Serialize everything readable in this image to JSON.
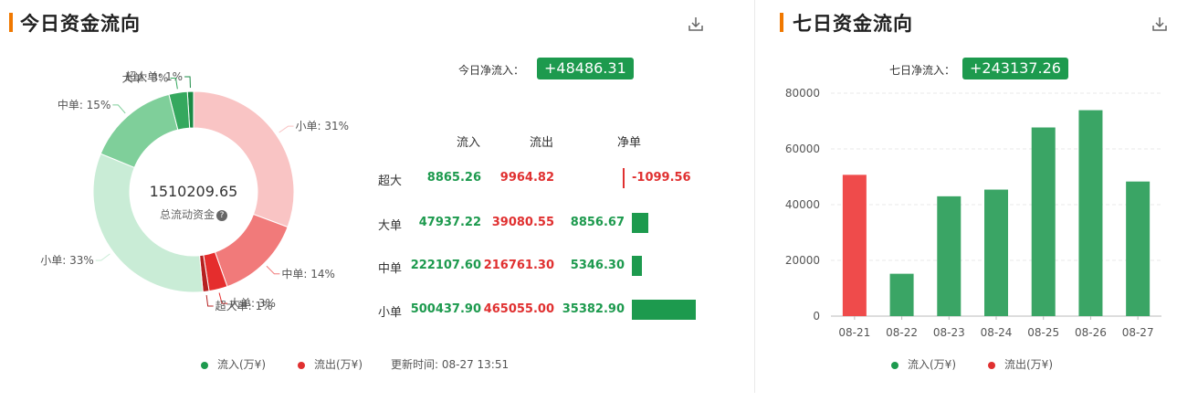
{
  "today": {
    "title": "今日资金流向",
    "net_label": "今日净流入：",
    "net_value": "+48486.31",
    "donut_total": "1510209.65",
    "donut_sub": "总流动资金",
    "table": {
      "headers": [
        "流入",
        "流出",
        "净单"
      ],
      "rows": [
        {
          "name": "超大",
          "inflow": "8865.26",
          "outflow": "9964.82",
          "net": "-1099.56",
          "net_num": -1099.56
        },
        {
          "name": "大单",
          "inflow": "47937.22",
          "outflow": "39080.55",
          "net": "8856.67",
          "net_num": 8856.67
        },
        {
          "name": "中单",
          "inflow": "222107.60",
          "outflow": "216761.30",
          "net": "5346.30",
          "net_num": 5346.3
        },
        {
          "name": "小单",
          "inflow": "500437.90",
          "outflow": "465055.00",
          "net": "35382.90",
          "net_num": 35382.9
        }
      ]
    },
    "legend": {
      "inflow": "流入(万¥)",
      "outflow": "流出(万¥)",
      "update": "更新时间: 08-27 13:51"
    }
  },
  "week": {
    "title": "七日资金流向",
    "net_label": "七日净流入：",
    "net_value": "+243137.26",
    "legend": {
      "inflow": "流入(万¥)",
      "outflow": "流出(万¥)"
    }
  },
  "colors": {
    "inflow": "#1d9a4e",
    "outflow": "#e03030",
    "accent": "#f07800",
    "bar_green": "#3aa565",
    "bar_red": "#ef4b4b"
  },
  "chart_data": [
    {
      "type": "pie",
      "donut": true,
      "slices": [
        {
          "label": "超大单: 1%",
          "value": 1,
          "group": "inflow",
          "color": "#1a8a44"
        },
        {
          "label": "大单: 3%",
          "value": 3,
          "group": "inflow",
          "color": "#35a85e"
        },
        {
          "label": "中单: 15%",
          "value": 15,
          "group": "inflow",
          "color": "#7fcf9a"
        },
        {
          "label": "小单: 33%",
          "value": 33,
          "group": "inflow",
          "color": "#c9ecd6"
        },
        {
          "label": "小单: 31%",
          "value": 31,
          "group": "outflow",
          "color": "#f9c4c4"
        },
        {
          "label": "中单: 14%",
          "value": 14,
          "group": "outflow",
          "color": "#f17a7a"
        },
        {
          "label": "大单: 3%",
          "value": 3,
          "group": "outflow",
          "color": "#e52d2d"
        },
        {
          "label": "超大单: 1%",
          "value": 1,
          "group": "outflow",
          "color": "#b52020"
        }
      ]
    },
    {
      "type": "bar",
      "categories": [
        "08-21",
        "08-22",
        "08-23",
        "08-24",
        "08-25",
        "08-26",
        "08-27"
      ],
      "values": [
        -50700,
        15200,
        43000,
        45400,
        67700,
        73900,
        48300
      ],
      "ylim": [
        0,
        80000
      ],
      "yticks": [
        "0",
        "20000",
        "40000",
        "60000",
        "80000"
      ],
      "grid": true
    }
  ]
}
